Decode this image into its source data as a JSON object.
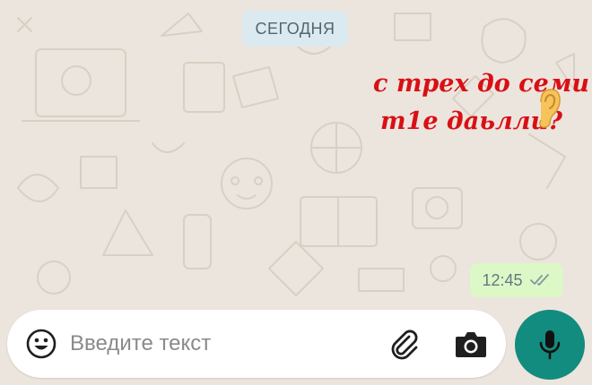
{
  "chat": {
    "date_separator": "СЕГОДНЯ",
    "sticker": {
      "line1": "с трех до семи",
      "line2": "т1е даьлли?",
      "emoji": "ear-icon"
    },
    "message": {
      "time": "12:45",
      "status_icon": "double-check-icon"
    }
  },
  "composer": {
    "placeholder": "Введите текст",
    "value": "",
    "emoji_icon": "emoji-icon",
    "attach_icon": "paperclip-icon",
    "camera_icon": "camera-icon",
    "mic_icon": "microphone-icon"
  },
  "colors": {
    "wallpaper": "#ece5dd",
    "date_pill": "#dbeaf1",
    "outgoing_bubble": "#dcf8c6",
    "accent": "#128c7e",
    "sticker_text": "#d90f16"
  }
}
